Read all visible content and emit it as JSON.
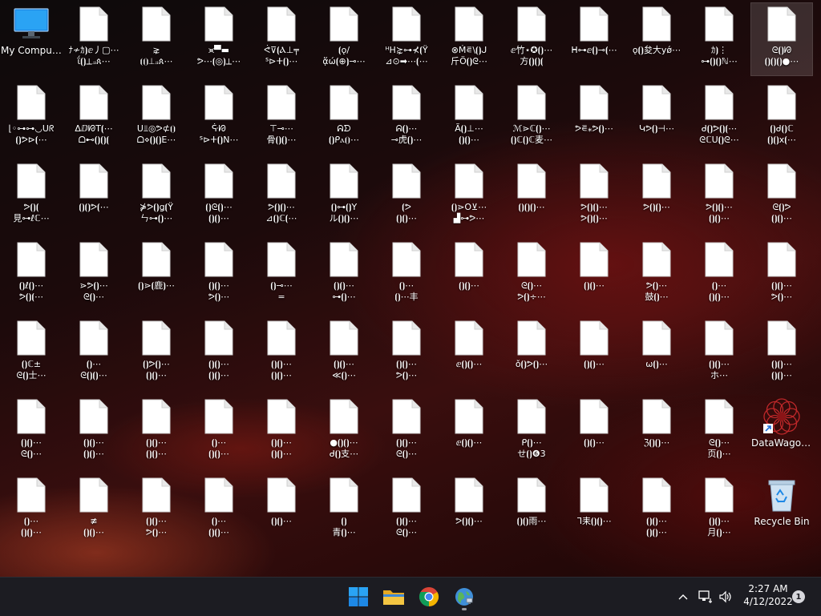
{
  "desktop": {
    "special": [
      {
        "name": "my-computer",
        "label": "My Computer",
        "icon": "monitor-icon",
        "row": 0,
        "col": 0
      },
      {
        "name": "datawagon",
        "label": "DataWagon...",
        "icon": "datawagon-shortcut-icon",
        "row": 5,
        "col": 12
      },
      {
        "name": "recycle-bin",
        "label": "Recycle Bin",
        "icon": "recycle-bin-icon",
        "row": 6,
        "col": 12
      }
    ],
    "selected": {
      "row": 0,
      "col": 12
    },
    "file_labels": [
      [
        "",
        "ﾅ≁ｶ⦘ⅇ丿▢⋯\nΐ⦗⦘⟂⟓ጰ⋯",
        "⋧\n⦗⦗⦘⟂⟓ጰ⋯",
        "⪤▀▬\nᕗ⋯⦗◎⦘⟂⋯",
        "ᕚ⊽⦗Ⲁ⊥╤\nᔆ⊳ⵜ⦗⦘⋯",
        "⦗ǫ/\nᾅώ⦗⊕⦘⊸⋯",
        "ᴴH⋩⊶⊀⦗Ÿ\n⊿⊙➡⋯⦗⋯",
        "⊗Ḿ⋷\\⦗⦘ᒍ\n⽄Ö⦗⦘ᘓ⋯",
        "ⅇ竹⋆✪⦗⦘⋯\n⽅⦗⦘⦗⦘⦗",
        "ᕼ⊶ⅇ⦗⦘⊸⦗⋯",
        "ǫ⦗⦘夋大yǿ⋯",
        "ｶ⦘⋮\n⊶⦗⦘⦗⦘ℕ⋯",
        "ᘓ⦗⦘ᘙ\n⦗⦘⦗⦘⦗⦘●⋯"
      ],
      [
        "⌊◦⊶⊶◡ᑌᖇ\n⦗⦘ᕗ⊳⦗⋯",
        "ΔⅅᘙT⦗⋯\nᗝ⊷⦗⦘⦗⦘⦗",
        "ᑌ⫫◎ᕗ⊄⦗⦘\nᗝ⋄⦗⦘⦗⦘Ε⋯",
        "ᕏᘙ\nᔆ⊳ⵜ⦗⦘Ν⋯",
        "⊤⊸⋯\n骨⦗⦘⦗⦘⋯",
        "ᕱᗤ\n⦗⦘ᑭⲁ⦗⦘⋯",
        "ᕱ⦗⦘⋯\n⊸虎⦗⦘⋯",
        "Ã⦗⦘⊥⋯\n⦗⦘⦗⦘⋯",
        "ℳ⋗ℂ⦗⦘⋯\n⦗⦘ℂ⦗⦘ℂ麦⋯",
        "ᕗ⋷⁎ᕗ⦗⦘⋯",
        "Կᕗ⦗⦘⊣⋯",
        "ᑯ⦗⦘ᕗ⦗⦘⦗⋯\nᘓℂᑌ⦗⦘ᘓ⋯",
        "⦗⦘ᑯ⦗⦘ℂ\n⦗⦘⦗⦘x⦗⋯"
      ],
      [
        "ᕗ⦗⦘⦗\n見⊶ℓℂ⋯",
        "⦗⦘⦗⦘ᕗ⦗⋯",
        "⋡ᕗ⦗⦘ǥ⦗Ÿ\nㄣ⊶⦗⦘⋯",
        "⦗⦘ᘓ⦗⦘⋯\n⦗⦘⦗⦘⋯",
        "ᕗ⦗⦘⦗⦘⋯\n⊿⦗⦘ℂ⦗⋯",
        "⦗⦘⊶⦗⦘Y\nル⦗⦘⦗⦘⋯",
        "⦗ᕗ\n⦗⦘⦗⦘⋯",
        "⦗⦘⋗O⊻⋯\n▟⊶ᕗ⋯",
        "⦗⦘⦗⦘⦗⦘⋯",
        "ᕗ⦗⦘⦗⦘⋯\nᕗ⦗⦘⦗⦘⋯",
        "ᕗ⦗⦘⦗⦘⋯",
        "ᕗ⦗⦘⦗⦘⋯\n⦗⦘⦗⦘⋯",
        "ᘓ⦗⦘ᕗ\n⦗⦘⦗⦘⋯"
      ],
      [
        "⦗⦘ℓ⦗⦘⋯\nᕗ⦗⦘⦗⋯",
        "⋗ᕗ⦗⦘⋯\nᘓ⦗⦘⋯",
        "⦗⦘⋗⦗鹿⦘⋯",
        "⦗⦘⦗⦘⋯\nᕗ⦗⦘⋯",
        "⦗⦘⊸⋯\n=",
        "⦗⦘⦗⦘⋯\n⊶⦗⦘⋯",
        "⦗⦘⋯\n⦗⦘⋯丰",
        "⦗⦘⦗⦘⋯",
        "ᘓ⦗⦘⋯\nᕗ⦗⦘÷⋯",
        "⦗⦘⦗⦘⋯",
        "ᕗ⦗⦘⋯\n鼓⦗⦘⋯",
        "⦗⦘⋯\n⦗⦘⦗⦘⋯",
        "⦗⦘⦗⦘⋯\nᕗ⦗⦘⋯"
      ],
      [
        "⦗⦘ℂ±\nᘓ⦗⦘士⋯",
        "⦗⦘⋯\nᘓ⦗⦘⦗⦘⋯",
        "⦗⦘ᕗ⦗⦘⋯\n⦗⦘⦗⦘⋯",
        "⦗⦘⦗⦘⋯\n⦗⦘⦗⦘⋯",
        "⦗⦘⦗⦘⋯\n⦗⦘⦗⦘⋯",
        "⦗⦘⦗⦘⋯\n≪⦗⦘⋯",
        "⦗⦘⦗⦘⋯\nᕗ⦗⦘⋯",
        "ⅇ⦗⦘⦗⦘⋯",
        "ǒ⦗⦘ᕗ⦗⦘⋯",
        "⦗⦘⦗⦘⋯",
        "ω⦗⦘⋯",
        "⦗⦘⦗⦘⋯\nホ⋯",
        "⦗⦘⦗⦘⋯\n⦗⦘⦗⦘⋯"
      ],
      [
        "⦗⦘⦗⦘⋯\nᘓ⦗⦘⋯",
        "⦗⦘⦗⦘⋯\n⦗⦘⦗⦘⋯",
        "⦗⦘⦗⦘⋯\n⦗⦘⦗⦘⋯",
        "⦗⦘⋯\n⦗⦘⦗⦘⋯",
        "⦗⦘⦗⦘⋯\n⦗⦘⦗⦘⋯",
        "●⦗⦘⦗⦘⋯\nᑯ⦗⦘支⋯",
        "⦗⦘⦗⦘⋯\nᘓ⦗⦘⋯",
        "ⅇ⦗⦘⦗⦘⋯",
        "ᑭ⦗⦘⋯\nせ⦗⦘❻3",
        "⦗⦘⦗⦘⋯",
        "ℨ⦗⦘⦗⦘⋯",
        "ᘓ⦗⦘⋯\n页⦗⦘⋯",
        ""
      ],
      [
        "⦗⦘⋯\n⦗⦘⦗⦘⋯",
        "≢\n⦗⦘⦗⦘⋯",
        "⦗⦘⦗⦘⋯\nᕗ⦗⦘⋯",
        "⦗⦘⋯\n⦗⦘⦗⦘⋯",
        "⦗⦘⦗⦘⋯",
        "⦗⦘\n青⦗⦘⋯",
        "⦗⦘⦗⦘⋯\nᘓ⦗⦘⋯",
        "ᕗ⦗⦘⦗⦘⋯",
        "⦗⦘⦗⦘雨⋯",
        "ᒣ耒⦗⦘⦗⦘⋯",
        "⦗⦘⦗⦘⋯\n⦗⦘⦗⦘⋯",
        "⦗⦘⦗⦘⋯\n月⦗⦘⋯",
        ""
      ]
    ]
  },
  "taskbar": {
    "apps": [
      {
        "name": "start-button",
        "icon": "windows-logo-icon",
        "running": false
      },
      {
        "name": "file-explorer-button",
        "icon": "folder-icon",
        "running": false
      },
      {
        "name": "chrome-button",
        "icon": "chrome-icon",
        "running": false
      },
      {
        "name": "network-globe-app-button",
        "icon": "globe-network-icon",
        "running": true
      }
    ],
    "tray": {
      "chevron_icon": "chevron-up-icon",
      "network_icon": "network-icon",
      "volume_icon": "volume-icon"
    },
    "clock": {
      "time": "2:27 AM",
      "date": "4/12/2022"
    },
    "notification_count": "1"
  },
  "colors": {
    "taskbar_bg": "#1c1c22",
    "accent_blue": "#1e88e5",
    "folder_yellow": "#f4c542"
  }
}
